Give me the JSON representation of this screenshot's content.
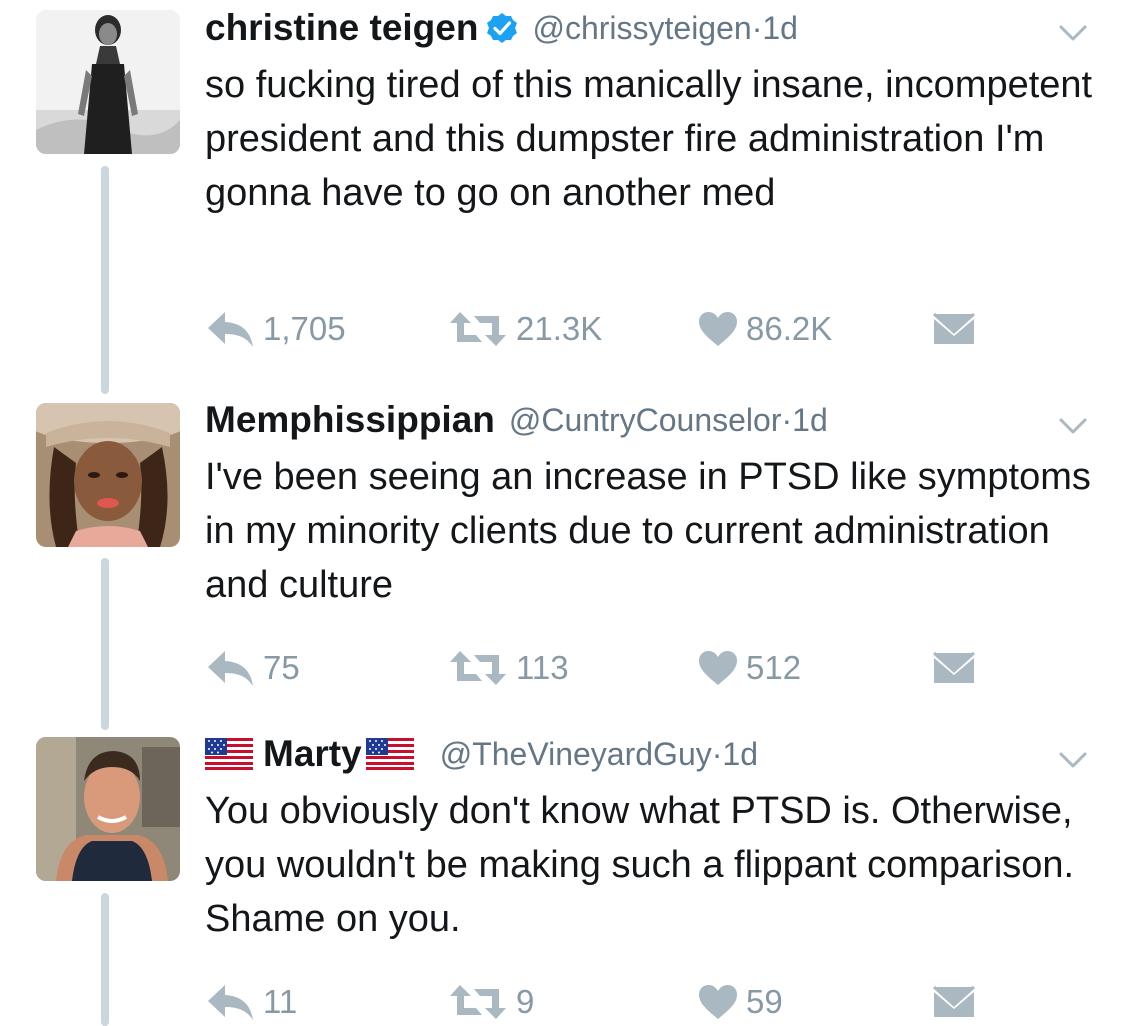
{
  "tweets": [
    {
      "name": "christine teigen",
      "verified": true,
      "handle": "@chrissyteigen",
      "time": "1d",
      "text": "so fucking tired of this manically insane, incompetent president and this dumpster fire administration I'm gonna have to go on another med",
      "replies": "1,705",
      "retweets": "21.3K",
      "likes": "86.2K"
    },
    {
      "name": "Memphissippian",
      "handle": "@CuntryCounselor",
      "time": "1d",
      "text": "I've been seeing an increase in PTSD like symptoms in my minority clients due to current administration and culture",
      "replies": "75",
      "retweets": "113",
      "likes": "512"
    },
    {
      "name": "Marty",
      "handle": "@TheVineyardGuy",
      "time": "1d",
      "text": "You obviously don't know what PTSD is. Otherwise, you wouldn't be making such a flippant comparison. Shame on you.",
      "replies": "11",
      "retweets": "9",
      "likes": "59"
    }
  ],
  "separator": " · ",
  "icons": {
    "reply": "reply-icon",
    "retweet": "retweet-icon",
    "like": "heart-icon",
    "dm": "envelope-icon",
    "more": "chevron-down-icon",
    "verified": "verified-badge-icon",
    "flag": "us-flag-icon"
  },
  "colors": {
    "name": "#14171a",
    "secondary": "#657786",
    "action": "#aab8c2",
    "verified": "#1da1f2",
    "thread_line": "#ccd6dd"
  }
}
